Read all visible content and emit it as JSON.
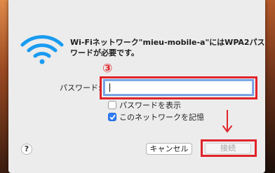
{
  "dialog": {
    "message": "Wi-Fiネットワーク\"mieu-mobile-a\"にはWPA2パスワードが必要です。",
    "step_badge": "③",
    "password_label": "パスワード:",
    "password_value": "",
    "show_password_label": "パスワードを表示",
    "show_password_checked": false,
    "remember_network_label": "このネットワークを記憶",
    "remember_network_checked": true,
    "help_label": "?",
    "cancel_label": "キャンセル",
    "connect_label": "接続"
  },
  "colors": {
    "annotation_red": "#e0242a",
    "wifi_blue": "#1a9bf0",
    "focus_ring": "#6fa0e6",
    "checkbox_blue": "#2f7cf6"
  },
  "icons": {
    "wifi": "wifi-icon",
    "arrow": "arrow-down-icon",
    "check": "checkmark-icon"
  }
}
